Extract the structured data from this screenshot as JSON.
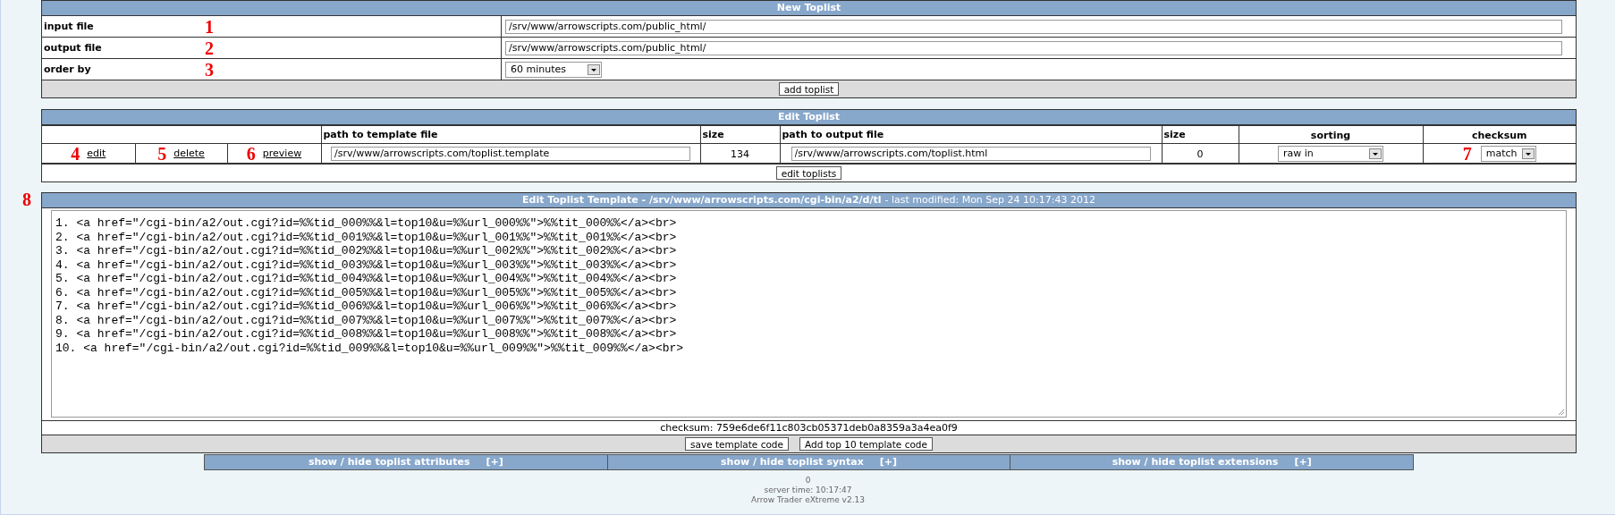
{
  "new_toplist": {
    "title": "New Toplist",
    "rows": [
      {
        "label": "input file",
        "marker": "1",
        "kind": "text",
        "value": "/srv/www/arrowscripts.com/public_html/"
      },
      {
        "label": "output file",
        "marker": "2",
        "kind": "text",
        "value": "/srv/www/arrowscripts.com/public_html/"
      },
      {
        "label": "order by",
        "marker": "3",
        "kind": "select",
        "value": "60 minutes"
      }
    ],
    "button": "add toplist"
  },
  "edit_toplist": {
    "title": "Edit Toplist",
    "columns": [
      "path to template file",
      "size",
      "path to output file",
      "size",
      "sorting",
      "checksum"
    ],
    "actions": [
      {
        "marker": "4",
        "label": "edit"
      },
      {
        "marker": "5",
        "label": "delete"
      },
      {
        "marker": "6",
        "label": "preview"
      }
    ],
    "template_path": "/srv/www/arrowscripts.com/toplist.template",
    "template_size": "134",
    "output_path": "/srv/www/arrowscripts.com/toplist.html",
    "output_size": "0",
    "sorting": "raw in",
    "checksum_marker": "7",
    "checksum": "match",
    "button": "edit toplists"
  },
  "template": {
    "marker": "8",
    "title": "Edit Toplist Template - /srv/www/arrowscripts.com/cgi-bin/a2/d/tl",
    "modified": "- last modified: Mon Sep 24 10:17:43 2012",
    "lines": [
      "1. <a href=\"/cgi-bin/a2/out.cgi?id=%%tid_000%%&l=top10&u=%%url_000%%\">%%tit_000%%</a><br>",
      "2. <a href=\"/cgi-bin/a2/out.cgi?id=%%tid_001%%&l=top10&u=%%url_001%%\">%%tit_001%%</a><br>",
      "3. <a href=\"/cgi-bin/a2/out.cgi?id=%%tid_002%%&l=top10&u=%%url_002%%\">%%tit_002%%</a><br>",
      "4. <a href=\"/cgi-bin/a2/out.cgi?id=%%tid_003%%&l=top10&u=%%url_003%%\">%%tit_003%%</a><br>",
      "5. <a href=\"/cgi-bin/a2/out.cgi?id=%%tid_004%%&l=top10&u=%%url_004%%\">%%tit_004%%</a><br>",
      "6. <a href=\"/cgi-bin/a2/out.cgi?id=%%tid_005%%&l=top10&u=%%url_005%%\">%%tit_005%%</a><br>",
      "7. <a href=\"/cgi-bin/a2/out.cgi?id=%%tid_006%%&l=top10&u=%%url_006%%\">%%tit_006%%</a><br>",
      "8. <a href=\"/cgi-bin/a2/out.cgi?id=%%tid_007%%&l=top10&u=%%url_007%%\">%%tit_007%%</a><br>",
      "9. <a href=\"/cgi-bin/a2/out.cgi?id=%%tid_008%%&l=top10&u=%%url_008%%\">%%tit_008%%</a><br>",
      "10. <a href=\"/cgi-bin/a2/out.cgi?id=%%tid_009%%&l=top10&u=%%url_009%%\">%%tit_009%%</a><br>"
    ],
    "checksum": "checksum: 759e6de6f11c803cb05371deb0a8359a3a4ea0f9",
    "buttons": [
      "save template code",
      "Add top 10 template code"
    ]
  },
  "toggles": [
    {
      "label": "show / hide toplist attributes",
      "toggle": "[+]"
    },
    {
      "label": "show / hide toplist syntax",
      "toggle": "[+]"
    },
    {
      "label": "show / hide toplist extensions",
      "toggle": "[+]"
    }
  ],
  "footer": [
    "0",
    "server time: 10:17:47",
    "Arrow Trader eXtreme v2.13"
  ]
}
